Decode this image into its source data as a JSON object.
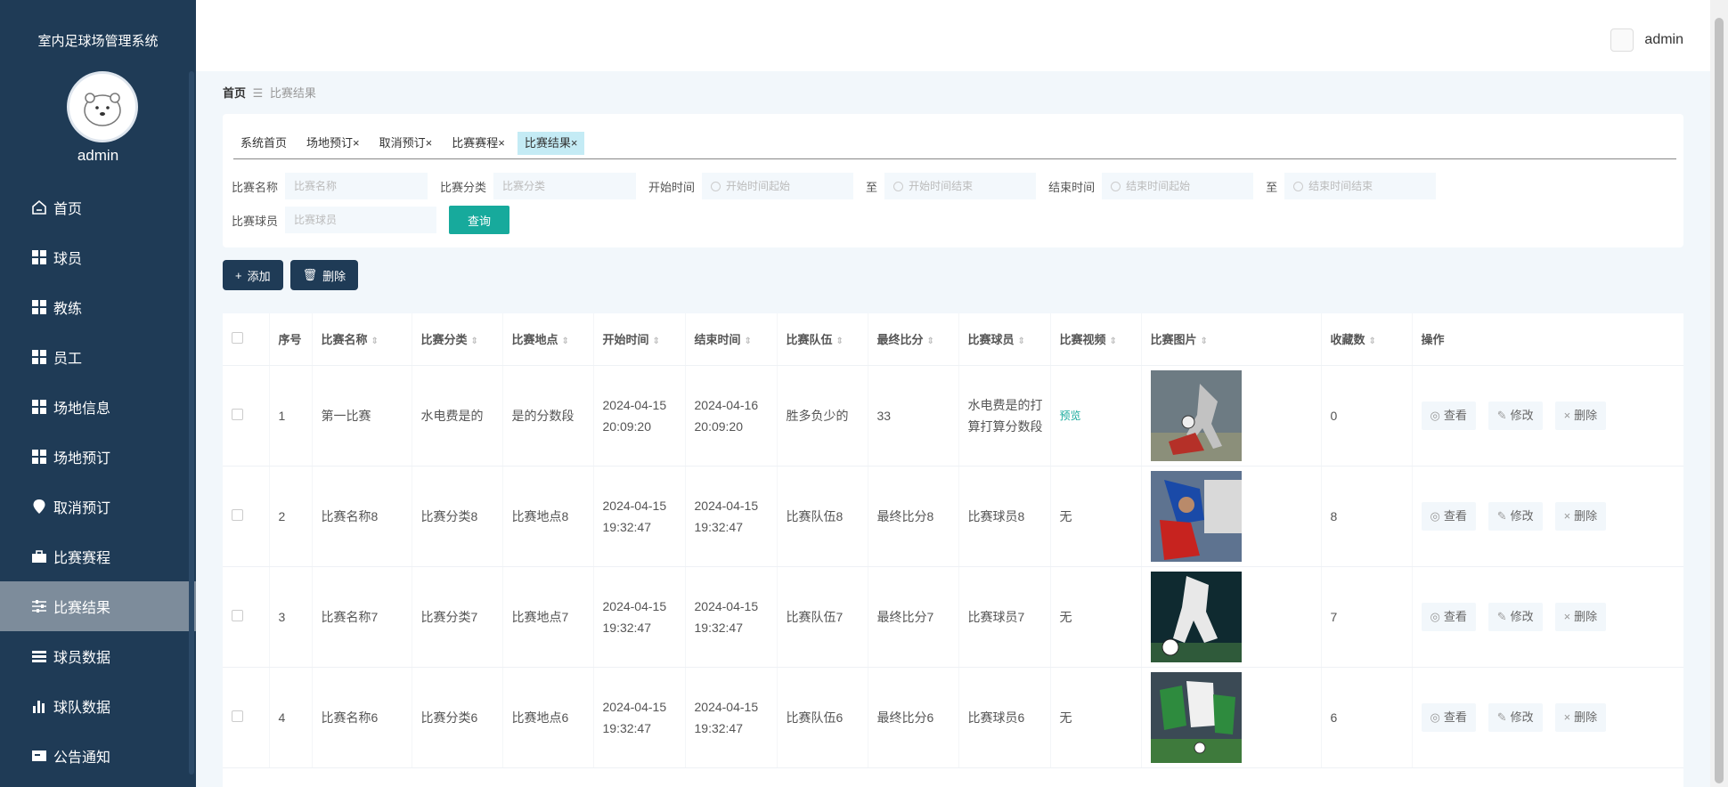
{
  "app": {
    "title": "室内足球场管理系统",
    "username": "admin"
  },
  "sidebar": {
    "items": [
      {
        "label": "首页",
        "icon": "home-icon"
      },
      {
        "label": "球员",
        "icon": "grid-icon"
      },
      {
        "label": "教练",
        "icon": "grid-icon"
      },
      {
        "label": "员工",
        "icon": "grid-icon"
      },
      {
        "label": "场地信息",
        "icon": "grid-icon"
      },
      {
        "label": "场地预订",
        "icon": "grid-icon"
      },
      {
        "label": "取消预订",
        "icon": "pin-icon"
      },
      {
        "label": "比赛赛程",
        "icon": "briefcase-icon"
      },
      {
        "label": "比赛结果",
        "icon": "sliders-icon",
        "active": true
      },
      {
        "label": "球员数据",
        "icon": "list-icon"
      },
      {
        "label": "球队数据",
        "icon": "bar-chart-icon"
      },
      {
        "label": "公告通知",
        "icon": "megaphone-icon"
      }
    ]
  },
  "header": {
    "username": "admin"
  },
  "breadcrumb": {
    "home": "首页",
    "separator": "☰",
    "current": "比赛结果"
  },
  "tabs": [
    {
      "label": "系统首页",
      "closable": false
    },
    {
      "label": "场地预订",
      "closable": true
    },
    {
      "label": "取消预订",
      "closable": true
    },
    {
      "label": "比赛赛程",
      "closable": true
    },
    {
      "label": "比赛结果",
      "closable": true,
      "active": true
    }
  ],
  "filters": {
    "name_label": "比赛名称",
    "name_placeholder": "比赛名称",
    "category_label": "比赛分类",
    "category_placeholder": "比赛分类",
    "start_label": "开始时间",
    "start_from": "开始时间起始",
    "to1": "至",
    "start_to": "开始时间结束",
    "end_label": "结束时间",
    "end_from": "结束时间起始",
    "to2": "至",
    "end_to": "结束时间结束",
    "player_label": "比赛球员",
    "player_placeholder": "比赛球员",
    "query_button": "查询"
  },
  "actions": {
    "add": "添加",
    "delete": "删除"
  },
  "table": {
    "columns": [
      "序号",
      "比赛名称",
      "比赛分类",
      "比赛地点",
      "开始时间",
      "结束时间",
      "比赛队伍",
      "最终比分",
      "比赛球员",
      "比赛视频",
      "比赛图片",
      "收藏数",
      "操作"
    ],
    "rows": [
      {
        "index": "1",
        "name": "第一比赛",
        "category": "水电费是的",
        "place": "是的分数段",
        "start": "2024-04-15 20:09:20",
        "end": "2024-04-16 20:09:20",
        "team": "胜多负少的",
        "score": "33",
        "player": "水电费是的打算打算分数段",
        "video": "预览",
        "favorites": "0"
      },
      {
        "index": "2",
        "name": "比赛名称8",
        "category": "比赛分类8",
        "place": "比赛地点8",
        "start": "2024-04-15 19:32:47",
        "end": "2024-04-15 19:32:47",
        "team": "比赛队伍8",
        "score": "最终比分8",
        "player": "比赛球员8",
        "video": "无",
        "favorites": "8"
      },
      {
        "index": "3",
        "name": "比赛名称7",
        "category": "比赛分类7",
        "place": "比赛地点7",
        "start": "2024-04-15 19:32:47",
        "end": "2024-04-15 19:32:47",
        "team": "比赛队伍7",
        "score": "最终比分7",
        "player": "比赛球员7",
        "video": "无",
        "favorites": "7"
      },
      {
        "index": "4",
        "name": "比赛名称6",
        "category": "比赛分类6",
        "place": "比赛地点6",
        "start": "2024-04-15 19:32:47",
        "end": "2024-04-15 19:32:47",
        "team": "比赛队伍6",
        "score": "最终比分6",
        "player": "比赛球员6",
        "video": "无",
        "favorites": "6"
      }
    ],
    "row_actions": {
      "view": "查看",
      "edit": "修改",
      "delete": "删除"
    }
  },
  "colors": {
    "sidebar_bg": "#1f3b56",
    "accent": "#17aa9c",
    "active_tab": "#c4ebf5"
  }
}
